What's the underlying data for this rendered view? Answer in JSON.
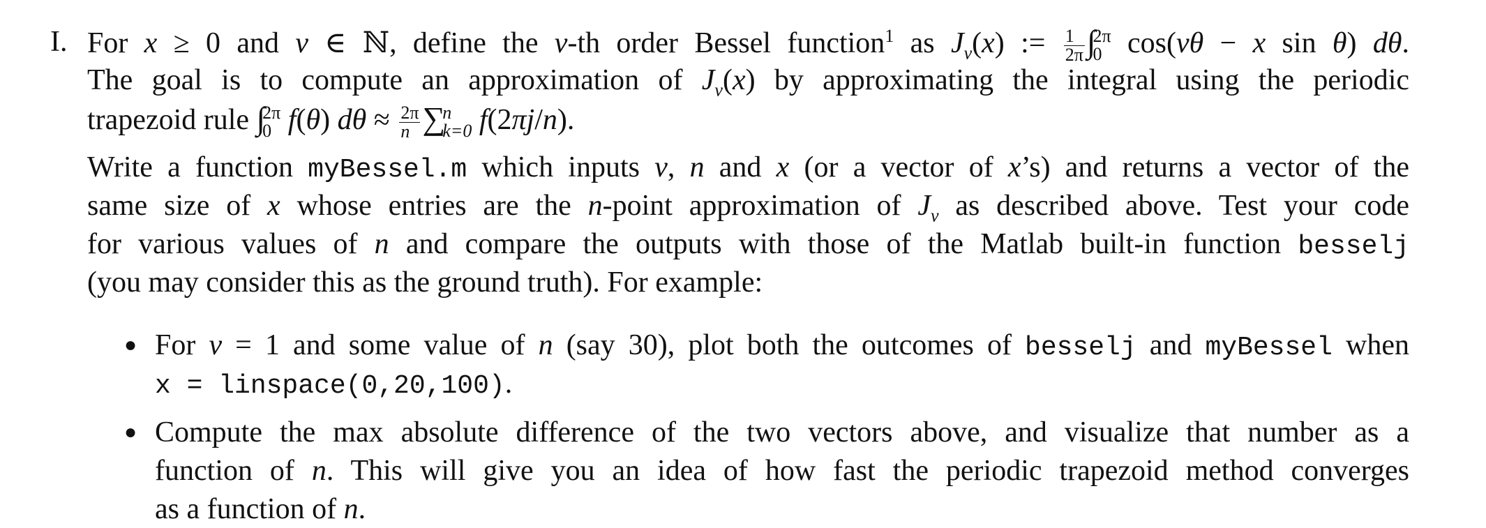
{
  "problem": {
    "enum_label": "I.",
    "para1": {
      "line1": {
        "t1": "For ",
        "m1": "x",
        "t2": " ≥ 0 and ",
        "m2": "ν",
        "t3": " ∈ ℕ, define the ",
        "m3": "ν",
        "t4": "-th order Bessel function",
        "footnote": "1",
        "t5": " as ",
        "m4": "J",
        "sub_nu": "ν",
        "t6": "(",
        "m5": "x",
        "t7": ") := ",
        "frac_num": "1",
        "frac_den": "2π",
        "int_upper": "2π",
        "int_lower": "0",
        "t8": " cos(",
        "m6": "νθ",
        "t9": " − ",
        "m7": "x",
        "t10": " sin ",
        "m8": "θ",
        "t11": ") ",
        "m9": "dθ",
        "t12": "."
      },
      "line2": {
        "t1": "The goal is to compute an approximation of ",
        "m1": "J",
        "sub_nu": "ν",
        "t2": "(",
        "m2": "x",
        "t3": ") by approximating the integral using the periodic"
      },
      "line3": {
        "t1": "trapezoid rule ",
        "int_upper": "2π",
        "int_lower": "0",
        "m1": " f",
        "t2": "(",
        "m2": "θ",
        "t3": ") ",
        "m3": "dθ",
        "t4": " ≈ ",
        "frac_num": "2π",
        "frac_den": "n",
        "sum": "∑",
        "sum_upper": "n",
        "sum_lower": "k=0",
        "m4": " f",
        "t5": "(2",
        "m5": "πj",
        "t6": "/",
        "m6": "n",
        "t7": ")."
      }
    },
    "para2": {
      "line1": {
        "t1": "Write a function ",
        "code1": "myBessel.m",
        "t2": " which inputs ",
        "m1": "ν",
        "t3": ", ",
        "m2": "n",
        "t4": " and ",
        "m3": "x",
        "t5": " (or a vector of ",
        "m4": "x",
        "t6": "’s) and returns a vector of the"
      },
      "line2": {
        "t1": "same size of ",
        "m1": "x",
        "t2": " whose entries are the ",
        "m2": "n",
        "t3": "-point approximation of ",
        "m3": "J",
        "sub_nu": "ν",
        "t4": " as described above. Test your code"
      },
      "line3": {
        "t1": "for various values of ",
        "m1": "n",
        "t2": " and compare the outputs with those of the Matlab built-in function ",
        "code1": "besselj"
      },
      "line4": {
        "t1": "(you may consider this as the ground truth). For example:"
      }
    },
    "bullets": [
      {
        "line1": {
          "t1": "For ",
          "m1": "ν",
          "t2": " = 1 and some value of ",
          "m2": "n",
          "t3": " (say 30), plot both the outcomes of ",
          "code1": "besselj",
          "t4": " and ",
          "code2": "myBessel",
          "t5": " when"
        },
        "line2": {
          "code1": "x = linspace(0,20,100)",
          "t1": "."
        }
      },
      {
        "line1": {
          "t1": "Compute the max absolute difference of the two vectors above, and visualize that number as a"
        },
        "line2": {
          "t1": "function of ",
          "m1": "n",
          "t2": ". This will give you an idea of how fast the periodic trapezoid method converges"
        },
        "line3": {
          "t1": "as a function of ",
          "m1": "n",
          "t2": "."
        }
      }
    ]
  }
}
